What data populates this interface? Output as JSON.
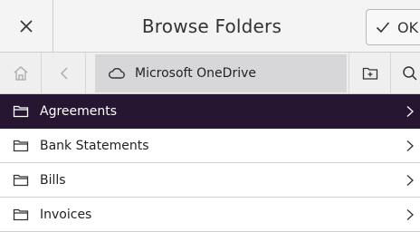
{
  "header": {
    "title": "Browse Folders",
    "ok_label": "OK",
    "close_icon": "close-icon",
    "ok_icon": "check-icon"
  },
  "navbar": {
    "home_icon": "home-icon",
    "back_icon": "chevron-left-icon",
    "location_icon": "cloud-icon",
    "location_label": "Microsoft OneDrive",
    "new_folder_icon": "new-folder-icon",
    "search_icon": "search-icon"
  },
  "folders": [
    {
      "label": "Agreements",
      "selected": true
    },
    {
      "label": "Bank Statements",
      "selected": false
    },
    {
      "label": "Bills",
      "selected": false
    },
    {
      "label": "Invoices",
      "selected": false
    }
  ],
  "colors": {
    "selected_row_bg": "#261631",
    "selected_row_text": "#ffffff"
  }
}
